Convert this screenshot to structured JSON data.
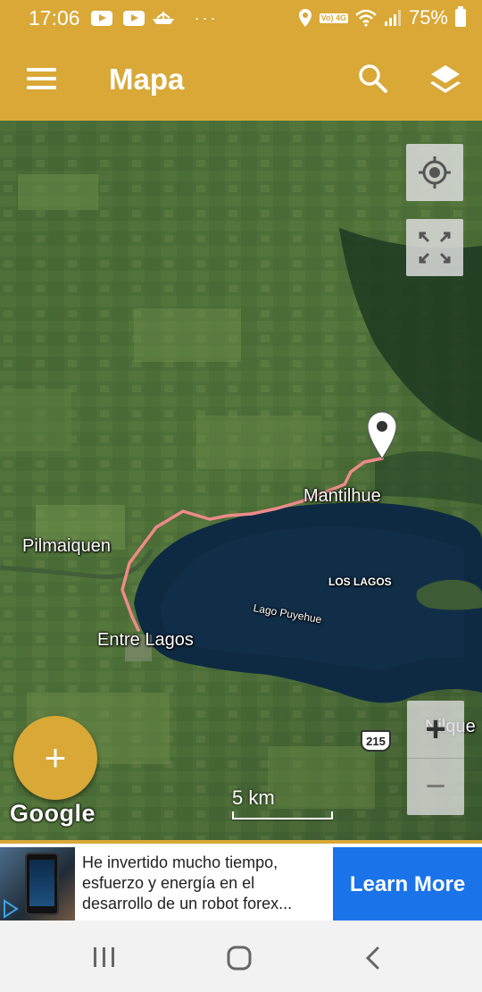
{
  "status_bar": {
    "time": "17:06",
    "dots": "···",
    "network": "Vo) 4G",
    "battery": "75%"
  },
  "app_bar": {
    "title": "Mapa",
    "icons": [
      "menu-icon",
      "search-icon",
      "layers-icon"
    ]
  },
  "map": {
    "labels": {
      "mantilhue": "Mantilhue",
      "pilmaiquen": "Pilmaiquen",
      "entre_lagos": "Entre Lagos",
      "los_lagos": "LOS LAGOS",
      "lago_puyehue": "Lago Puyehue",
      "nilque": "Nilque"
    },
    "route_shield": "215",
    "scale": "5 km",
    "attribution": "Google",
    "colors": {
      "route": "#ef8a8a",
      "accent": "#d9a837"
    },
    "controls": [
      "my-location-icon",
      "fullscreen-icon",
      "zoom-in",
      "zoom-out"
    ],
    "zoom_in": "+",
    "zoom_out": "−",
    "fab": "+"
  },
  "ad": {
    "text": "He invertido mucho tiempo, esfuerzo y energía en el desarrollo de un robot forex...",
    "cta": "Learn More"
  },
  "nav_bar": {
    "icons": [
      "recent-apps-icon",
      "home-icon",
      "back-icon"
    ]
  }
}
